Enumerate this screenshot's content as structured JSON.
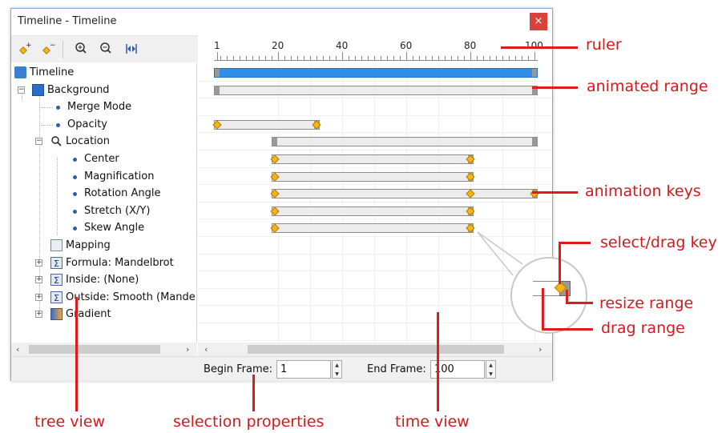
{
  "window": {
    "title": "Timeline - Timeline",
    "close_label": "×"
  },
  "toolbar": {
    "icons": [
      "add-key-icon",
      "remove-key-icon",
      "zoom-in-icon",
      "zoom-out-icon",
      "zoom-fit-icon"
    ]
  },
  "tree": {
    "items": [
      {
        "label": "Timeline",
        "icon": "timeline-icon"
      },
      {
        "label": "Background",
        "icon": "layer-icon",
        "expander": "−"
      },
      {
        "label": "Merge Mode"
      },
      {
        "label": "Opacity"
      },
      {
        "label": "Location",
        "icon": "magnifier-icon",
        "expander": "−"
      },
      {
        "label": "Center"
      },
      {
        "label": "Magnification"
      },
      {
        "label": "Rotation Angle"
      },
      {
        "label": "Stretch (X/Y)"
      },
      {
        "label": "Skew Angle"
      },
      {
        "label": "Mapping",
        "icon": "mapping-icon"
      },
      {
        "label": "Formula: Mandelbrot",
        "icon": "formula-icon",
        "expander": "+"
      },
      {
        "label": "Inside: (None)",
        "icon": "formula-icon",
        "expander": "+"
      },
      {
        "label": "Outside: Smooth (Mande",
        "icon": "formula-icon",
        "expander": "+"
      },
      {
        "label": "Gradient",
        "icon": "gradient-icon",
        "expander": "+"
      }
    ]
  },
  "ruler": {
    "labels": [
      "1",
      "20",
      "40",
      "60",
      "80",
      "100"
    ]
  },
  "bottom": {
    "begin_label": "Begin Frame:",
    "begin_value": "1",
    "end_label": "End Frame:",
    "end_value": "100"
  },
  "annotations": {
    "ruler": "ruler",
    "animated_range": "animated range",
    "animation_keys": "animation keys",
    "select_drag_key": "select/drag key",
    "resize_range": "resize range",
    "drag_range": "drag range",
    "tree_view": "tree view",
    "selection_properties": "selection properties",
    "time_view": "time view"
  },
  "colors": {
    "range_selected": "#2f8ee8",
    "range_normal": "#ececec",
    "key_fill": "#f6b41a",
    "annotation": "#d7191c"
  }
}
